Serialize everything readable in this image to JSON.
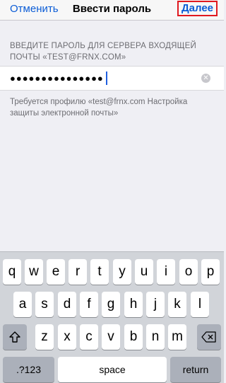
{
  "nav": {
    "cancel_label": "Отменить",
    "title": "Ввести пароль",
    "next_label": "Далее"
  },
  "section": {
    "header": "ВВЕДИТЕ ПАРОЛЬ ДЛЯ СЕРВЕРА ВХОДЯЩЕЙ ПОЧТЫ «TEST@FRNX.COM»"
  },
  "password_field": {
    "value": "●●●●●●●●●●●●●●●"
  },
  "footer_note": "Требуется профилю «test@frnx.com Настройка защиты электронной почты»",
  "keyboard": {
    "row1": [
      "q",
      "w",
      "e",
      "r",
      "t",
      "y",
      "u",
      "i",
      "o",
      "p"
    ],
    "row2": [
      "a",
      "s",
      "d",
      "f",
      "g",
      "h",
      "j",
      "k",
      "l"
    ],
    "row3": [
      "z",
      "x",
      "c",
      "v",
      "b",
      "n",
      "m"
    ],
    "numbers_label": ".?123",
    "space_label": "space",
    "return_label": "return",
    "shift_icon": "shift-icon",
    "backspace_icon": "backspace-icon"
  },
  "colors": {
    "accent": "#0b5cd6",
    "highlight_border": "#e0191f",
    "keyboard_bg": "#d1d4d9"
  }
}
